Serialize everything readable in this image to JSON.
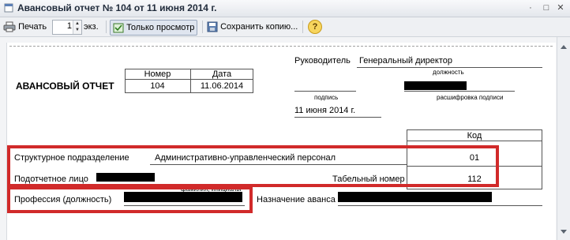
{
  "window": {
    "title": "Авансовый отчет № 104 от 11 июня 2014 г.",
    "controls": [
      "·",
      "□",
      "✕"
    ]
  },
  "toolbar": {
    "print_label": "Печать",
    "copies_value": "1",
    "copies_unit": "экз.",
    "readonly_label": "Только просмотр",
    "save_copy_label": "Сохранить копию...",
    "help_label": "?"
  },
  "document": {
    "head": {
      "label": "Руководитель",
      "value": "Генеральный директор",
      "position_caption": "должность",
      "signature_caption": "подпись",
      "decode_caption": "расшифровка подписи",
      "date": "11 июня 2014 г."
    },
    "title": "АВАНСОВЫЙ ОТЧЕТ",
    "number_header": "Номер",
    "date_header": "Дата",
    "number": "104",
    "date": "11.06.2014",
    "code_header": "Код",
    "structural_unit_label": "Структурное подразделение",
    "structural_unit_value": "Административно-управленческий персонал",
    "structural_unit_code": "01",
    "accountable_person_label": "Подотчетное лицо",
    "name_caption": "фамилия, инициалы",
    "tab_number_label": "Табельный номер",
    "tab_number_value": "112",
    "profession_label": "Профессия (должность)",
    "advance_purpose_label": "Назначение аванса"
  }
}
